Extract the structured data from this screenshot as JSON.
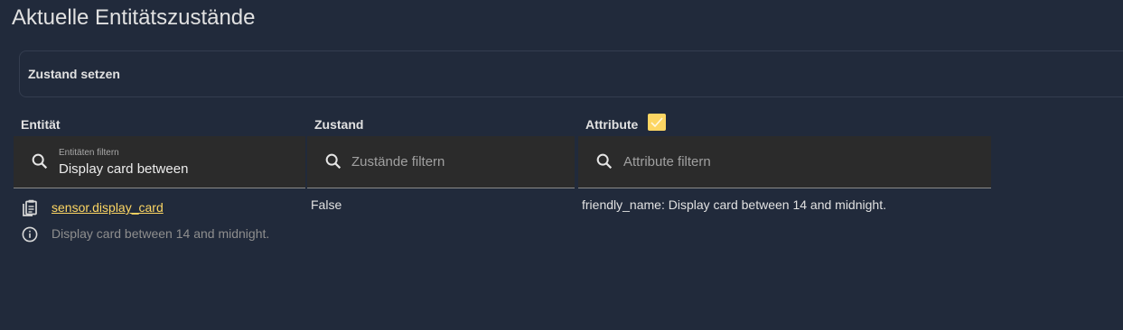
{
  "page": {
    "title": "Aktuelle Entitätszustände"
  },
  "set_state": {
    "label": "Zustand setzen"
  },
  "columns": {
    "entity": "Entität",
    "state": "Zustand",
    "attributes": "Attribute",
    "attributes_checkbox_checked": true
  },
  "filters": {
    "entity": {
      "label": "Entitäten filtern",
      "value": "Display card between"
    },
    "state": {
      "placeholder": "Zustände filtern"
    },
    "attributes": {
      "placeholder": "Attribute filtern"
    }
  },
  "rows": [
    {
      "entity_id": "sensor.display_card",
      "friendly_name": "Display card between 14 and midnight.",
      "state": "False",
      "attributes": "friendly_name: Display card between 14 and midnight."
    }
  ],
  "colors": {
    "background": "#212a3b",
    "accent": "#fdd663",
    "filter_background": "#2b2b2b"
  },
  "icons": [
    "search-icon",
    "copy-clipboard-icon",
    "info-icon",
    "checkmark-icon"
  ]
}
